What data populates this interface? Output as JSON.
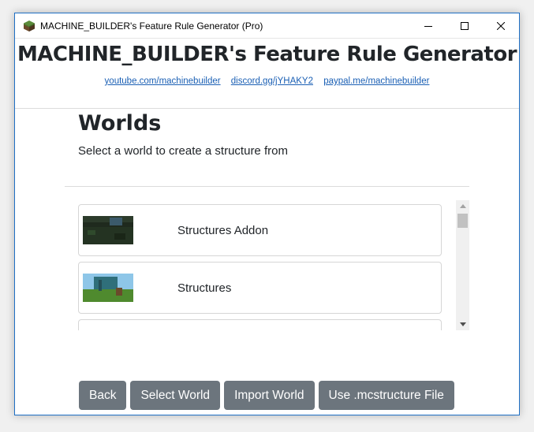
{
  "window": {
    "title": "MACHINE_BUILDER's Feature Rule Generator (Pro)"
  },
  "header": {
    "heading": "MACHINE_BUILDER's Feature Rule Generator",
    "links": [
      "youtube.com/machinebuilder",
      "discord.gg/jYHAKY2",
      "paypal.me/machinebuilder"
    ]
  },
  "section": {
    "title": "Worlds",
    "subtitle": "Select a world to create a structure from"
  },
  "worlds": [
    {
      "name": "Structures Addon"
    },
    {
      "name": "Structures"
    },
    {
      "name": ""
    }
  ],
  "buttons": {
    "back": "Back",
    "select_world": "Select World",
    "import_world": "Import World",
    "use_mcstructure": "Use .mcstructure File"
  },
  "colors": {
    "accent": "#1f6fc4",
    "button": "#6c757d",
    "link": "#1a5fb4"
  }
}
